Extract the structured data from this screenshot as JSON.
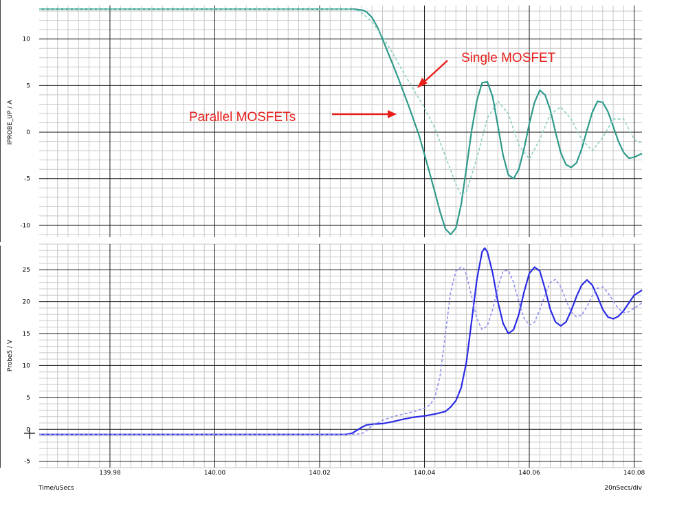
{
  "colors": {
    "background": "#ffffff",
    "grid_minor": "#c8c8c8",
    "grid_major": "#1a1a1a",
    "current_solid": "#2e9a8a",
    "current_dashed": "#8ccfc2",
    "voltage_solid": "#2a2ae6",
    "voltage_dashed": "#8e8ef2",
    "annotation": "#e8201c"
  },
  "footer": {
    "x_label": "Time/uSecs",
    "scale_label": "20nSecs/div"
  },
  "annotations": {
    "single": "Single MOSFET",
    "parallel": "Parallel MOSFETs"
  },
  "chart_data": [
    {
      "type": "line",
      "ylabel": "IPROBE_UP / A",
      "xlabel": "Time/uSecs",
      "xlim": [
        139.9665,
        140.0815
      ],
      "ylim": [
        -11.3,
        13.6
      ],
      "yticks": [
        -10,
        -5,
        0,
        5,
        10
      ],
      "ytick_labels": [
        "-10",
        "-5",
        "0",
        "5",
        "10"
      ],
      "xticks": [],
      "xtick_labels": [],
      "grid": true,
      "series": [
        {
          "name": "Parallel MOSFETs",
          "style": "solid",
          "x": [
            139.9665,
            140.02,
            140.0268,
            140.0282,
            140.029,
            140.03,
            140.031,
            140.032,
            140.033,
            140.034,
            140.035,
            140.036,
            140.037,
            140.038,
            140.039,
            140.04,
            140.041,
            140.042,
            140.043,
            140.044,
            140.045,
            140.046,
            140.047,
            140.048,
            140.049,
            140.05,
            140.051,
            140.052,
            140.053,
            140.054,
            140.055,
            140.056,
            140.057,
            140.058,
            140.059,
            140.06,
            140.061,
            140.062,
            140.063,
            140.064,
            140.065,
            140.066,
            140.067,
            140.068,
            140.069,
            140.07,
            140.071,
            140.072,
            140.073,
            140.074,
            140.075,
            140.076,
            140.077,
            140.078,
            140.079,
            140.08,
            140.0815
          ],
          "y": [
            13.2,
            13.2,
            13.2,
            13.1,
            12.9,
            12.3,
            11.3,
            10.0,
            8.6,
            7.2,
            5.8,
            4.3,
            2.8,
            1.2,
            -0.4,
            -2.4,
            -4.4,
            -6.5,
            -8.6,
            -10.4,
            -11.0,
            -10.3,
            -7.8,
            -3.9,
            0.2,
            3.4,
            5.3,
            5.4,
            3.8,
            0.7,
            -2.5,
            -4.6,
            -5.0,
            -4.0,
            -1.8,
            0.9,
            3.2,
            4.5,
            4.0,
            2.4,
            0.0,
            -2.2,
            -3.5,
            -3.8,
            -3.3,
            -1.8,
            0.2,
            2.1,
            3.3,
            3.2,
            2.2,
            0.6,
            -1.0,
            -2.2,
            -2.8,
            -2.7,
            -2.3
          ]
        },
        {
          "name": "Single MOSFET",
          "style": "dashed",
          "x": [
            139.9665,
            140.02,
            140.026,
            140.0275,
            140.0285,
            140.03,
            140.032,
            140.034,
            140.036,
            140.038,
            140.04,
            140.042,
            140.044,
            140.046,
            140.047,
            140.048,
            140.05,
            140.052,
            140.054,
            140.056,
            140.058,
            140.06,
            140.062,
            140.064,
            140.066,
            140.068,
            140.07,
            140.072,
            140.074,
            140.076,
            140.078,
            140.08,
            140.0815
          ],
          "y": [
            13.2,
            13.2,
            13.2,
            13.0,
            12.6,
            11.8,
            10.3,
            8.4,
            6.4,
            4.5,
            2.6,
            0.4,
            -2.6,
            -5.6,
            -6.8,
            -6.4,
            -2.8,
            1.5,
            3.3,
            2.0,
            -1.4,
            -2.9,
            -0.8,
            1.9,
            2.7,
            1.4,
            -0.8,
            -2.0,
            -0.6,
            1.4,
            1.4,
            -0.8,
            -1.2
          ]
        }
      ]
    },
    {
      "type": "line",
      "ylabel": "Probe5 / V",
      "xlabel": "Time/uSecs",
      "xlim": [
        139.9665,
        140.0815
      ],
      "ylim": [
        -6,
        29
      ],
      "yticks": [
        -5,
        0,
        5,
        10,
        15,
        20,
        25
      ],
      "ytick_labels": [
        "-5",
        "0",
        "5",
        "10",
        "15",
        "20",
        "25"
      ],
      "xticks": [
        139.98,
        140.0,
        140.02,
        140.04,
        140.06,
        140.08
      ],
      "xtick_labels": [
        "139.98",
        "140.00",
        "140.02",
        "140.04",
        "140.06",
        "140.08"
      ],
      "grid": true,
      "series": [
        {
          "name": "Parallel MOSFETs",
          "style": "solid",
          "x": [
            139.9665,
            140.025,
            140.0262,
            140.0272,
            140.0282,
            140.029,
            140.03,
            140.032,
            140.034,
            140.036,
            140.038,
            140.04,
            140.042,
            140.044,
            140.045,
            140.046,
            140.047,
            140.048,
            140.049,
            140.05,
            140.051,
            140.0515,
            140.052,
            140.053,
            140.054,
            140.055,
            140.056,
            140.057,
            140.058,
            140.059,
            140.06,
            140.061,
            140.062,
            140.063,
            140.064,
            140.065,
            140.066,
            140.067,
            140.068,
            140.069,
            140.07,
            140.071,
            140.072,
            140.073,
            140.074,
            140.075,
            140.076,
            140.077,
            140.078,
            140.079,
            140.08,
            140.0815
          ],
          "y": [
            -0.8,
            -0.8,
            -0.6,
            -0.1,
            0.4,
            0.7,
            0.8,
            0.9,
            1.2,
            1.6,
            1.9,
            2.1,
            2.4,
            2.8,
            3.5,
            4.5,
            6.5,
            10.5,
            17.0,
            23.5,
            27.8,
            28.4,
            27.8,
            24.5,
            20.0,
            16.6,
            15.0,
            15.6,
            18.0,
            21.5,
            24.4,
            25.4,
            24.8,
            22.0,
            18.8,
            16.8,
            16.2,
            16.8,
            18.6,
            20.8,
            22.6,
            23.4,
            22.6,
            20.8,
            18.8,
            17.6,
            17.3,
            17.7,
            18.6,
            19.8,
            21.0,
            21.8
          ]
        },
        {
          "name": "Single MOSFET",
          "style": "dashed",
          "x": [
            139.9665,
            140.025,
            140.028,
            140.029,
            140.03,
            140.032,
            140.034,
            140.036,
            140.038,
            140.04,
            140.041,
            140.042,
            140.043,
            140.044,
            140.045,
            140.046,
            140.047,
            140.0475,
            140.048,
            140.049,
            140.05,
            140.051,
            140.052,
            140.053,
            140.054,
            140.055,
            140.056,
            140.057,
            140.058,
            140.059,
            140.06,
            140.061,
            140.062,
            140.063,
            140.064,
            140.065,
            140.066,
            140.067,
            140.068,
            140.069,
            140.07,
            140.071,
            140.072,
            140.073,
            140.074,
            140.075,
            140.076,
            140.077,
            140.078,
            140.079,
            140.08,
            140.0815
          ],
          "y": [
            -0.8,
            -0.8,
            -0.7,
            -0.2,
            0.6,
            1.4,
            2.0,
            2.4,
            2.8,
            3.3,
            3.8,
            5.0,
            8.5,
            15.0,
            21.5,
            24.8,
            25.4,
            25.2,
            24.2,
            20.8,
            17.3,
            15.6,
            16.2,
            18.8,
            22.2,
            24.8,
            24.9,
            23.0,
            19.9,
            17.4,
            16.3,
            16.8,
            18.7,
            21.0,
            23.0,
            23.5,
            22.3,
            20.2,
            18.4,
            17.6,
            17.9,
            19.2,
            20.9,
            22.1,
            22.3,
            21.4,
            20.1,
            18.9,
            18.3,
            18.4,
            19.0,
            19.8
          ]
        }
      ]
    }
  ]
}
